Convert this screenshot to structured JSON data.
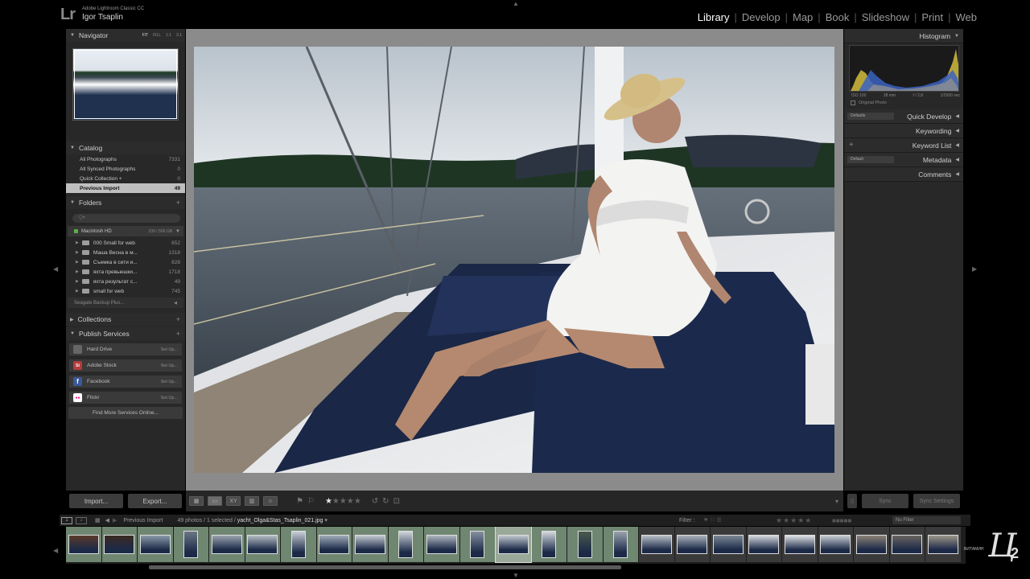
{
  "app": {
    "logo": "Lr",
    "product": "Adobe Lightroom Classic CC",
    "user": "Igor Tsaplin"
  },
  "modules": [
    "Library",
    "Develop",
    "Map",
    "Book",
    "Slideshow",
    "Print",
    "Web"
  ],
  "active_module": "Library",
  "navigator": {
    "title": "Navigator",
    "zoom_options": [
      "FIT",
      "FILL",
      "1:1",
      "3:1"
    ]
  },
  "catalog": {
    "title": "Catalog",
    "items": [
      {
        "label": "All Photographs",
        "count": "7331"
      },
      {
        "label": "All Synced Photographs",
        "count": "0"
      },
      {
        "label": "Quick Collection +",
        "count": "0"
      },
      {
        "label": "Previous Import",
        "count": "49",
        "selected": true
      }
    ]
  },
  "folders": {
    "title": "Folders",
    "volume": {
      "name": "Macintosh HD",
      "size": "239 / 500 GB"
    },
    "items": [
      {
        "name": "000 Small for web",
        "count": "652"
      },
      {
        "name": "Маша Весна в м...",
        "count": "1318"
      },
      {
        "name": "Съемка в сити и...",
        "count": "828"
      },
      {
        "name": "яхта превьюшки...",
        "count": "1718"
      },
      {
        "name": "яхта результат с...",
        "count": "49"
      },
      {
        "name": "small for web",
        "count": "745"
      }
    ],
    "volume2": "Seagate Backup Plus..."
  },
  "collections": {
    "title": "Collections"
  },
  "publish": {
    "title": "Publish Services",
    "items": [
      {
        "name": "Hard Drive",
        "action": "Set Up...",
        "icon": "hard-drive-icon",
        "color": "#666666",
        "glyph": ""
      },
      {
        "name": "Adobe Stock",
        "action": "Set Up...",
        "icon": "adobe-stock-icon",
        "color": "#b43c3c",
        "glyph": "St"
      },
      {
        "name": "Facebook",
        "action": "Set Up...",
        "icon": "facebook-icon",
        "color": "#3b5998",
        "glyph": "f"
      },
      {
        "name": "Flickr",
        "action": "Set Up...",
        "icon": "flickr-icon",
        "color": "#2d55a8",
        "glyph": "●●"
      }
    ],
    "find_more": "Find More Services Online..."
  },
  "left_buttons": {
    "import": "Import...",
    "export": "Export..."
  },
  "right_panel": {
    "histogram_title": "Histogram",
    "exif": {
      "iso": "ISO 100",
      "focal": "28 mm",
      "aperture": "f / 2,8",
      "shutter": "1/2500 sec"
    },
    "original_photo": "Original Photo",
    "quick_develop": {
      "title": "Quick Develop",
      "preset": "Defaults"
    },
    "keywording": "Keywording",
    "keyword_list": "Keyword List",
    "metadata": {
      "title": "Metadata",
      "preset": "Default"
    },
    "comments": "Comments",
    "sync": "Sync",
    "sync_settings": "Sync Settings"
  },
  "toolbar": {
    "rating": 1,
    "max_rating": 5
  },
  "filmstrip": {
    "source": "Previous Import",
    "info_prefix": "49 photos / 1 selected /",
    "filename": "yacht_Olga&Stas_Tsaplin_021.jpg",
    "filter_label": "Filter :",
    "filter_value": "No Filter",
    "thumbs": [
      {
        "o": "l",
        "c": "#5a3a2a",
        "p": true
      },
      {
        "o": "l",
        "c": "#3b2a22",
        "p": true
      },
      {
        "o": "l",
        "c": "#8a9aa8",
        "p": true
      },
      {
        "o": "p",
        "c": "#6c7684",
        "p": true
      },
      {
        "o": "l",
        "c": "#9aa3ae",
        "p": true
      },
      {
        "o": "l",
        "c": "#b5bcc4",
        "p": true
      },
      {
        "o": "p",
        "c": "#c9cfd6",
        "p": true
      },
      {
        "o": "l",
        "c": "#a0abb7",
        "p": true
      },
      {
        "o": "l",
        "c": "#c4cad1",
        "p": true
      },
      {
        "o": "p",
        "c": "#d0d5db",
        "p": true
      },
      {
        "o": "l",
        "c": "#aeb6be",
        "p": true
      },
      {
        "o": "p",
        "c": "#8690a0",
        "p": true
      },
      {
        "o": "l",
        "c": "#c0c7ce",
        "p": true,
        "sel": true
      },
      {
        "o": "p",
        "c": "#d3d8dd",
        "p": true
      },
      {
        "o": "p",
        "c": "#4a5a4c",
        "p": true
      },
      {
        "o": "p",
        "c": "#9aa4ae",
        "p": true
      },
      {
        "o": "l",
        "c": "#b8bfc6",
        "p": false
      },
      {
        "o": "l",
        "c": "#aab2bb",
        "p": false
      },
      {
        "o": "l",
        "c": "#7c8794",
        "p": false
      },
      {
        "o": "l",
        "c": "#d5d9dd",
        "p": false
      },
      {
        "o": "l",
        "c": "#dfe2e5",
        "p": false
      },
      {
        "o": "l",
        "c": "#c9ced3",
        "p": false
      },
      {
        "o": "l",
        "c": "#8a8276",
        "p": false
      },
      {
        "o": "l",
        "c": "#6a6460",
        "p": false
      },
      {
        "o": "l",
        "c": "#9c9488",
        "p": false
      }
    ]
  },
  "watermark": {
    "text": "ВИТАМИН",
    "mark": "Ц",
    "num": "2"
  }
}
